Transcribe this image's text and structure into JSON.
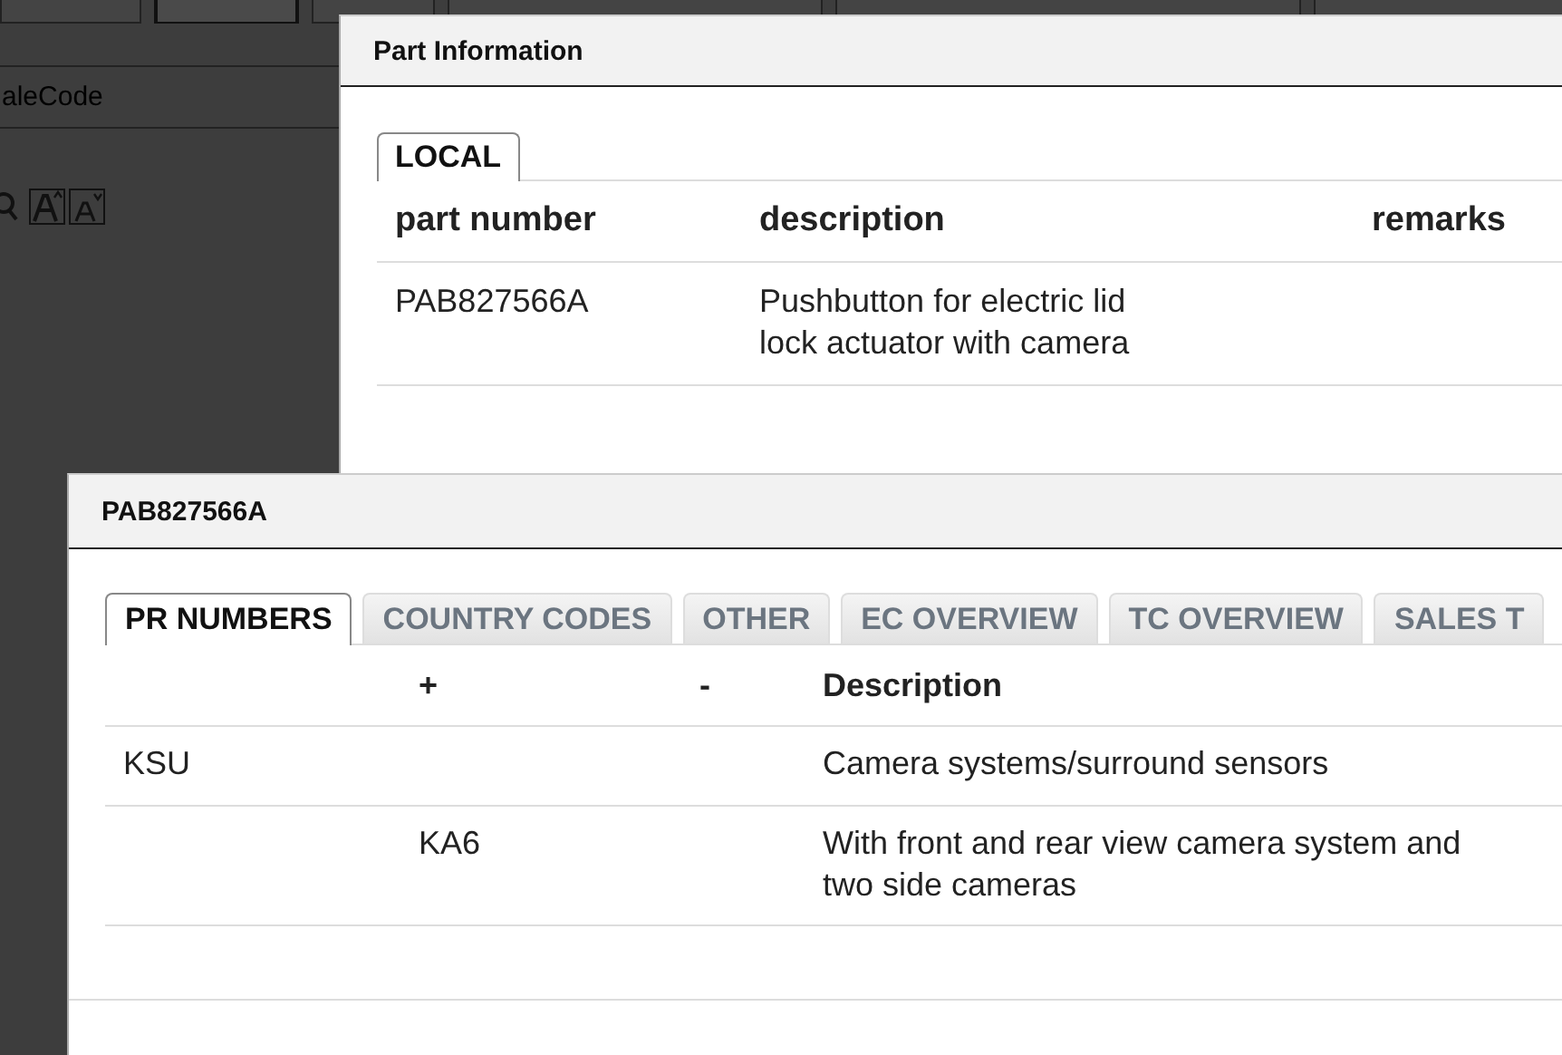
{
  "background": {
    "tabs": [
      {
        "selected": false
      },
      {
        "selected": true
      },
      {
        "selected": false
      },
      {
        "selected": false
      },
      {
        "selected": false
      },
      {
        "selected": false
      }
    ],
    "field": {
      "placeholder": "aleCode"
    }
  },
  "part_information": {
    "title": "Part Information",
    "tabs": [
      {
        "label": "LOCAL",
        "selected": true
      }
    ],
    "table": {
      "columns": [
        "part number",
        "description",
        "remarks"
      ],
      "rows": [
        {
          "part_number": "PAB827566A",
          "description": "Pushbutton for electric lid lock actuator with camera"
        }
      ]
    }
  },
  "part_detail": {
    "title": "PAB827566A",
    "tabs": [
      {
        "label": "PR NUMBERS",
        "selected": true
      },
      {
        "label": "COUNTRY CODES",
        "selected": false
      },
      {
        "label": "OTHER",
        "selected": false
      },
      {
        "label": "EC OVERVIEW",
        "selected": false
      },
      {
        "label": "TC OVERVIEW",
        "selected": false
      },
      {
        "label": "SALES T",
        "selected": false
      }
    ],
    "table": {
      "columns": [
        "+",
        "-",
        "Description"
      ],
      "rows": [
        {
          "column_1": "KSU",
          "description": "Camera systems/surround sensors"
        },
        {
          "plus": "KA6",
          "description": "With front and rear view camera system and two side cameras"
        }
      ]
    }
  }
}
